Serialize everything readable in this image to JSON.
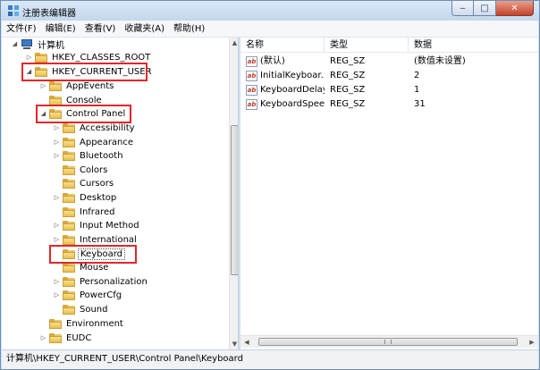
{
  "window": {
    "title": "注册表编辑器"
  },
  "window_buttons": {
    "minimize": "‒",
    "maximize": "□",
    "close": "✕"
  },
  "menu": [
    "文件(F)",
    "编辑(E)",
    "查看(V)",
    "收藏夹(A)",
    "帮助(H)"
  ],
  "tree": {
    "root": "计算机",
    "hkcr": "HKEY_CLASSES_ROOT",
    "hkcu": "HKEY_CURRENT_USER",
    "appevents": "AppEvents",
    "console": "Console",
    "control_panel": "Control Panel",
    "children": [
      "Accessibility",
      "Appearance",
      "Bluetooth",
      "Colors",
      "Cursors",
      "Desktop",
      "Infrared",
      "Input Method",
      "International",
      "Keyboard",
      "Mouse",
      "Personalization",
      "PowerCfg",
      "Sound"
    ],
    "environment": "Environment",
    "eudc": "EUDC"
  },
  "list": {
    "headers": [
      "名称",
      "类型",
      "数据"
    ],
    "rows": [
      {
        "name": "(默认)",
        "type": "REG_SZ",
        "data": "(数值未设置)"
      },
      {
        "name": "InitialKeyboar...",
        "type": "REG_SZ",
        "data": "2"
      },
      {
        "name": "KeyboardDelay",
        "type": "REG_SZ",
        "data": "1"
      },
      {
        "name": "KeyboardSpeed",
        "type": "REG_SZ",
        "data": "31"
      }
    ]
  },
  "status": "计算机\\HKEY_CURRENT_USER\\Control Panel\\Keyboard",
  "highlight_color": "#e1272b"
}
